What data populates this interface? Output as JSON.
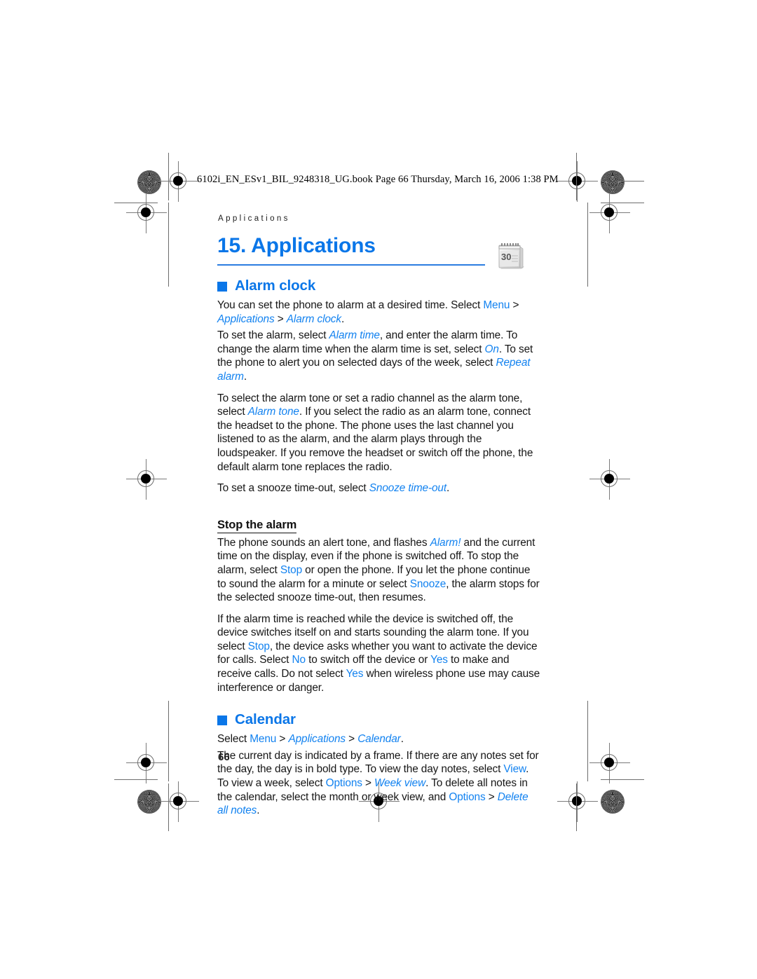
{
  "page": {
    "file_header": "6102i_EN_ESv1_BIL_9248318_UG.book  Page 66  Thursday, March 16, 2006  1:38 PM",
    "running_head": "Applications",
    "page_number": "66",
    "accent_color": "#0a76e8",
    "link_color": "#1282f0",
    "text_color": "#161616",
    "chapter_icon": "desk-calendar-icon"
  },
  "chapter": {
    "title": "15. Applications"
  },
  "sections": [
    {
      "heading": "Alarm clock",
      "paragraphs": [
        [
          {
            "t": "You can set the phone to alarm at a desired time. Select ",
            "s": "bk"
          },
          {
            "t": "Menu",
            "s": "b"
          },
          {
            "t": " > ",
            "s": "bk"
          },
          {
            "t": "Applications",
            "s": "i"
          },
          {
            "t": " > ",
            "s": "bk"
          },
          {
            "t": "Alarm clock",
            "s": "i"
          },
          {
            "t": ".",
            "s": "bk"
          }
        ],
        [
          {
            "t": "To set the alarm, select ",
            "s": "bk"
          },
          {
            "t": "Alarm time",
            "s": "i"
          },
          {
            "t": ", and enter the alarm time. To change the alarm time when the alarm time is set, select ",
            "s": "bk"
          },
          {
            "t": "On",
            "s": "i"
          },
          {
            "t": ". To set the phone to alert you on selected days of the week, select ",
            "s": "bk"
          },
          {
            "t": "Repeat alarm",
            "s": "i"
          },
          {
            "t": ".",
            "s": "bk"
          }
        ],
        [
          {
            "t": "To select the alarm tone or set a radio channel as the alarm tone, select ",
            "s": "bk"
          },
          {
            "t": "Alarm tone",
            "s": "i"
          },
          {
            "t": ". If you select the radio as an alarm tone, connect the headset to the phone. The phone uses the last channel you listened to as the alarm, and the alarm plays through the loudspeaker. If you remove the headset or switch off the phone, the default alarm tone replaces the radio.",
            "s": "bk"
          }
        ],
        [
          {
            "t": "To set a snooze time-out, select ",
            "s": "bk"
          },
          {
            "t": "Snooze time-out",
            "s": "i"
          },
          {
            "t": ".",
            "s": "bk"
          }
        ]
      ],
      "subsection": {
        "heading": "Stop the alarm",
        "paragraphs": [
          [
            {
              "t": "The phone sounds an alert tone, and flashes ",
              "s": "bk"
            },
            {
              "t": "Alarm!",
              "s": "i"
            },
            {
              "t": " and the current time on the display, even if the phone is switched off. To stop the alarm, select ",
              "s": "bk"
            },
            {
              "t": "Stop",
              "s": "b"
            },
            {
              "t": " or open the phone. If you let the phone continue to sound the alarm for a minute or select ",
              "s": "bk"
            },
            {
              "t": "Snooze",
              "s": "b"
            },
            {
              "t": ", the alarm stops for the selected snooze time-out, then resumes.",
              "s": "bk"
            }
          ],
          [
            {
              "t": "If the alarm time is reached while the device is switched off, the device switches itself on and starts sounding the alarm tone. If you select ",
              "s": "bk"
            },
            {
              "t": "Stop",
              "s": "b"
            },
            {
              "t": ", the device asks whether you want to activate the device for calls. Select ",
              "s": "bk"
            },
            {
              "t": "No",
              "s": "b"
            },
            {
              "t": " to switch off the device or ",
              "s": "bk"
            },
            {
              "t": "Yes",
              "s": "b"
            },
            {
              "t": " to make and receive calls. Do not select ",
              "s": "bk"
            },
            {
              "t": "Yes",
              "s": "b"
            },
            {
              "t": " when wireless phone use may cause interference or danger.",
              "s": "bk"
            }
          ]
        ]
      }
    },
    {
      "heading": "Calendar",
      "paragraphs": [
        [
          {
            "t": "Select ",
            "s": "bk"
          },
          {
            "t": "Menu",
            "s": "b"
          },
          {
            "t": " > ",
            "s": "bk"
          },
          {
            "t": "Applications",
            "s": "i"
          },
          {
            "t": " > ",
            "s": "bk"
          },
          {
            "t": "Calendar",
            "s": "i"
          },
          {
            "t": ".",
            "s": "bk"
          }
        ],
        [
          {
            "t": "The current day is indicated by a frame. If there are any notes set for the day, the day is in bold type. To view the day notes, select ",
            "s": "bk"
          },
          {
            "t": "View",
            "s": "b"
          },
          {
            "t": ". To view a week, select ",
            "s": "bk"
          },
          {
            "t": "Options",
            "s": "b"
          },
          {
            "t": " > ",
            "s": "bk"
          },
          {
            "t": "Week view",
            "s": "i"
          },
          {
            "t": ". To delete all notes in the calendar, select the month or week view, and ",
            "s": "bk"
          },
          {
            "t": "Options",
            "s": "b"
          },
          {
            "t": " > ",
            "s": "bk"
          },
          {
            "t": "Delete all notes",
            "s": "i"
          },
          {
            "t": ".",
            "s": "bk"
          }
        ]
      ]
    }
  ]
}
